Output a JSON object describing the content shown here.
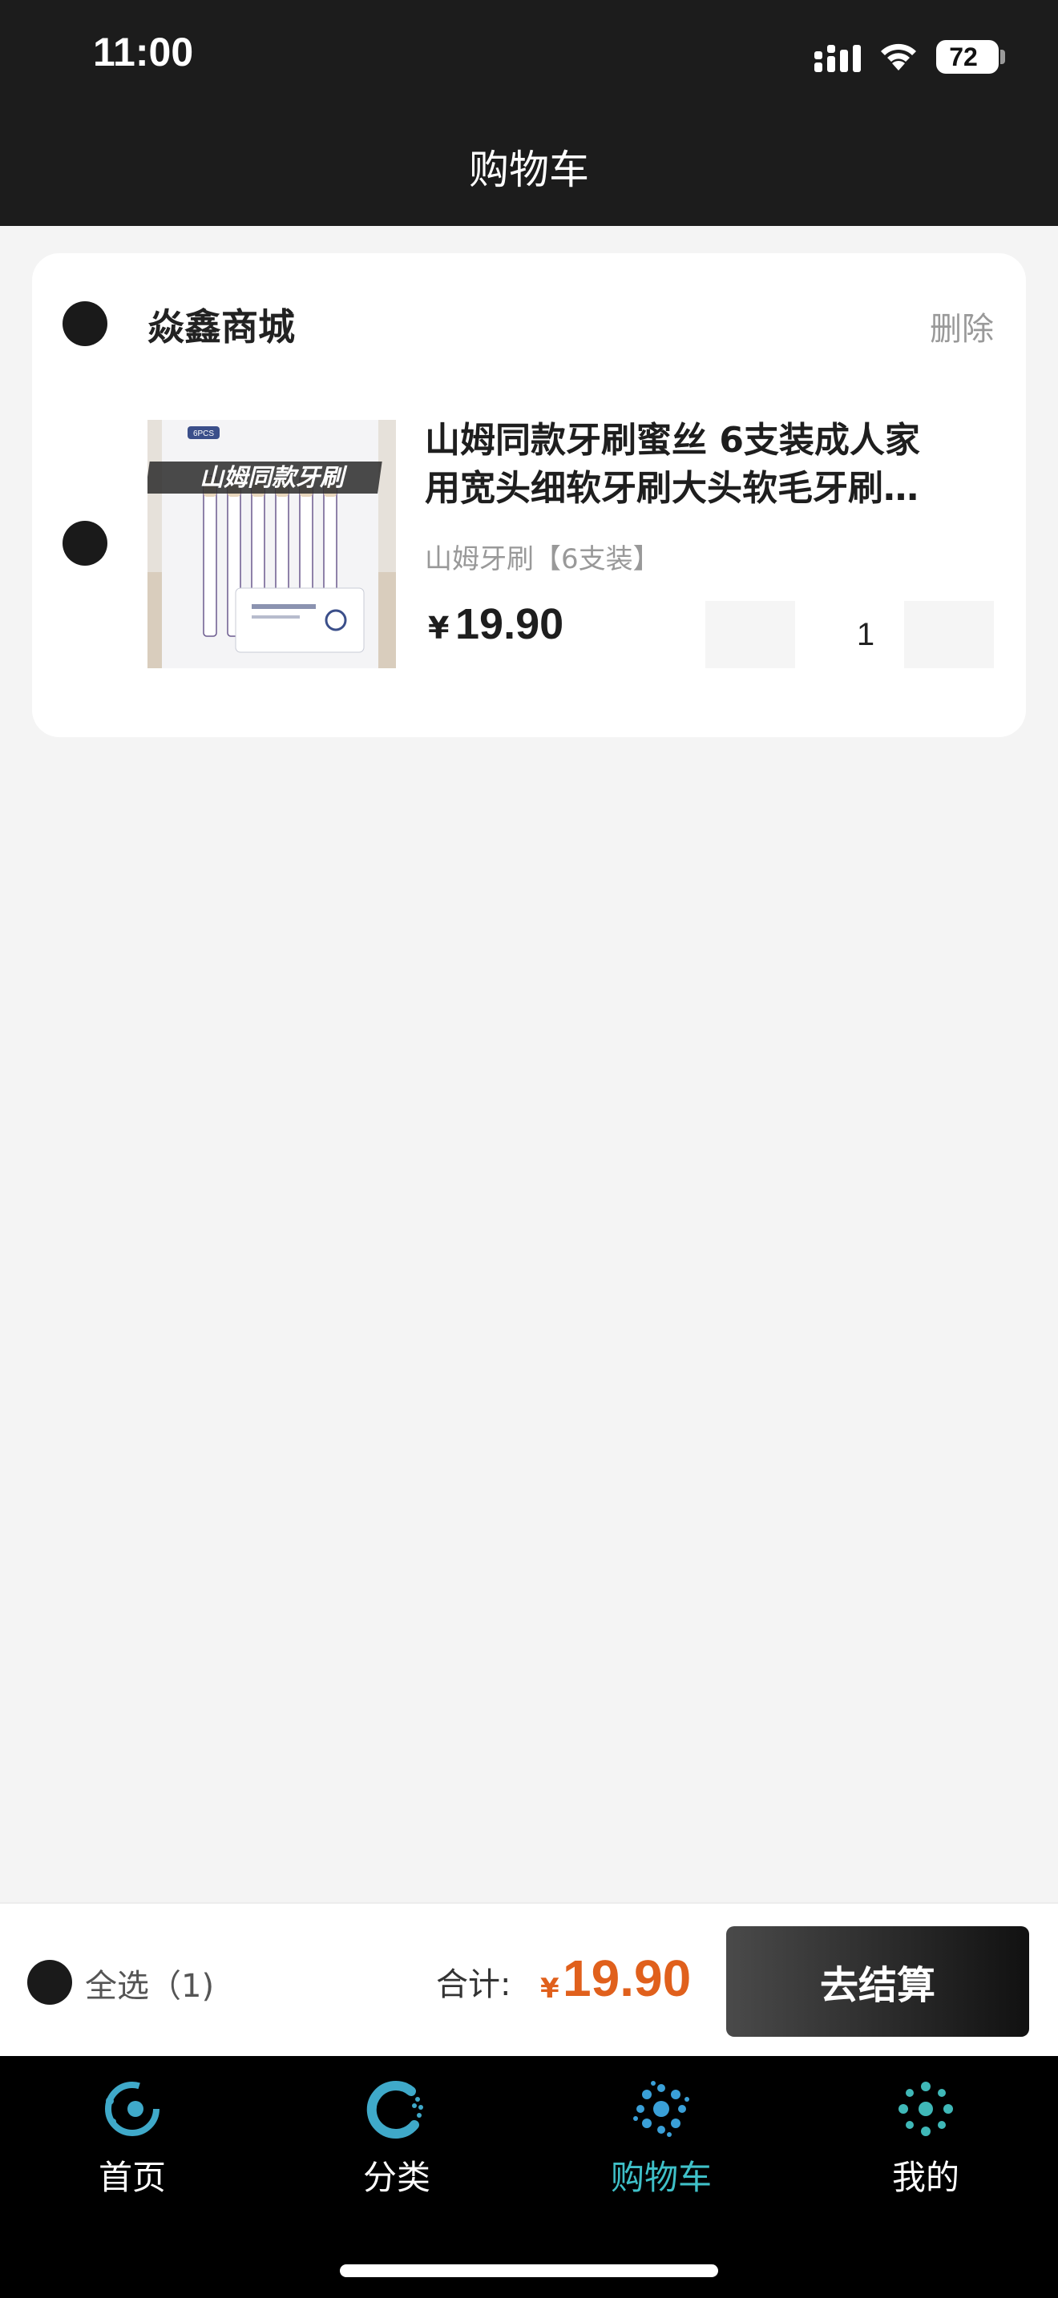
{
  "status_bar": {
    "time": "11:00",
    "battery": "72",
    "icons": [
      "signal-icon",
      "wifi-icon",
      "battery-icon"
    ]
  },
  "header": {
    "title": "购物车"
  },
  "cart": {
    "shop_name": "焱鑫商城",
    "delete_label": "删除",
    "item": {
      "title_line1": "山姆同款牙刷蜜丝 6支装成人家",
      "title_line2": "用宽头细软牙刷大头软毛牙刷…",
      "spec": "山姆牙刷【6支装】",
      "price_symbol": "¥",
      "price": "19.90",
      "quantity": "1",
      "image_text": "山姆同款牙刷",
      "image_badge": "6PCS"
    }
  },
  "checkout": {
    "select_all_label": "全选（1)",
    "total_label": "合计:",
    "total_symbol": "¥",
    "total_value": "19.90",
    "button_label": "去结算"
  },
  "tabs": [
    {
      "label": "首页",
      "icon": "home-icon",
      "active": false
    },
    {
      "label": "分类",
      "icon": "category-icon",
      "active": false
    },
    {
      "label": "购物车",
      "icon": "cart-icon",
      "active": true
    },
    {
      "label": "我的",
      "icon": "profile-icon",
      "active": false
    }
  ],
  "colors": {
    "header_bg": "#1c1c1c",
    "accent_price": "#e0601c",
    "active_tab": "#3fc0c8",
    "tab_icon": "#3fa9c9"
  }
}
